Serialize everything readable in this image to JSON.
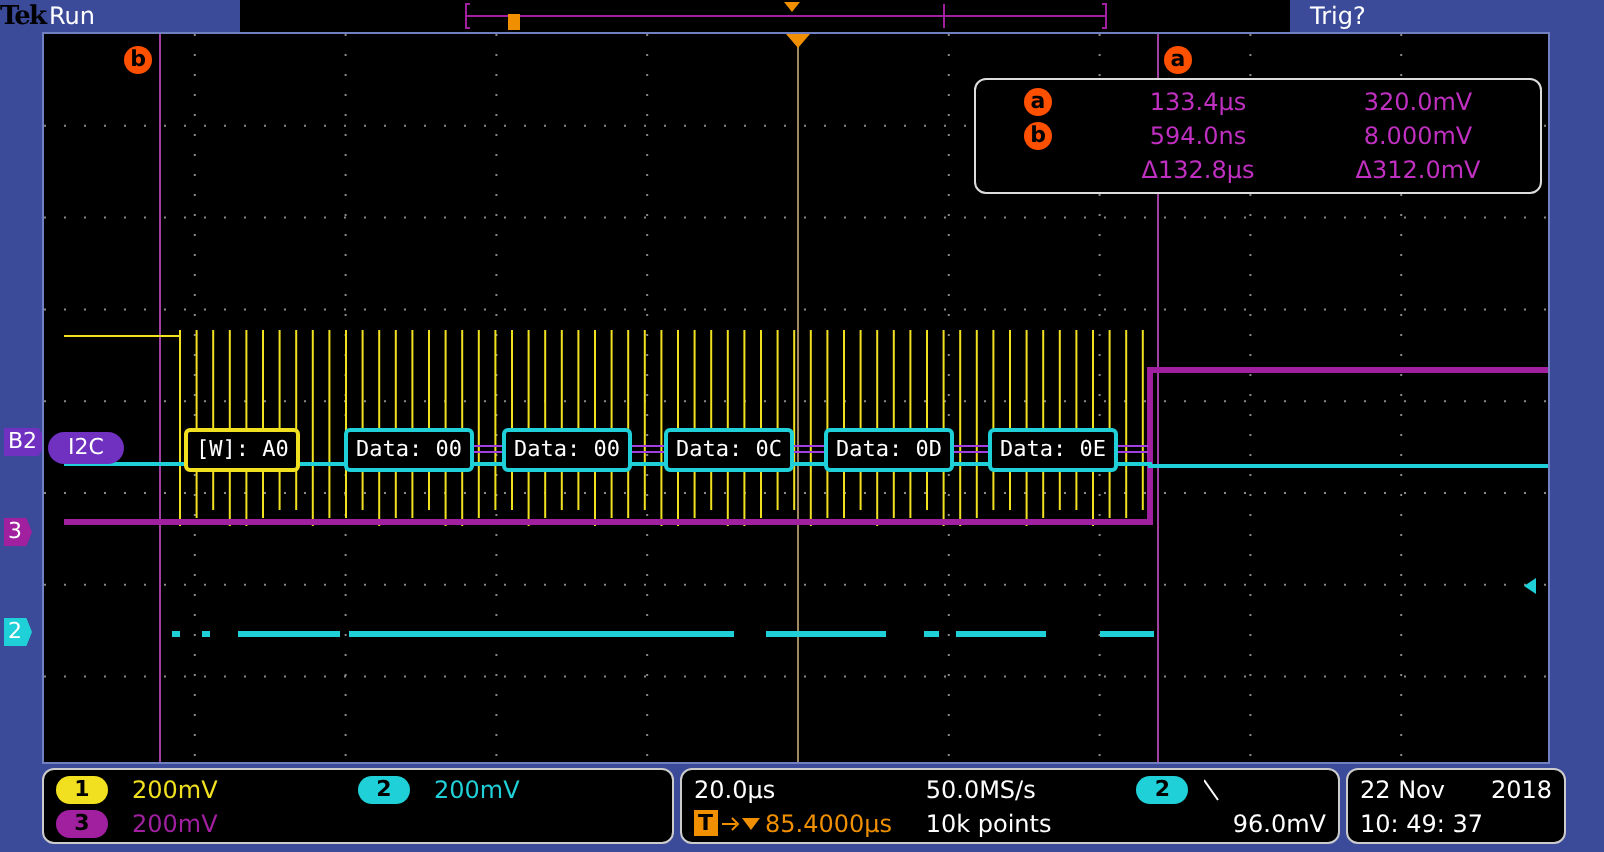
{
  "header": {
    "brand": "Tek",
    "status": "Run",
    "trigger_status": "Trig?"
  },
  "cursor_labels": [
    {
      "marker": "b"
    },
    {
      "marker": "a"
    }
  ],
  "readout": [
    {
      "marker": "a",
      "time": "133.4µs",
      "value": "320.0mV"
    },
    {
      "marker": "b",
      "time": "594.0ns",
      "value": "8.000mV"
    },
    {
      "time": "Δ132.8µs",
      "value": "Δ312.0mV"
    }
  ],
  "side_markers": [
    {
      "label": "B2",
      "color": "#7030c0"
    },
    {
      "label": "3",
      "color": "#a020a0"
    },
    {
      "label": "2",
      "color": "#20d0d8"
    }
  ],
  "bus": {
    "name": "I2C",
    "packets": [
      {
        "kind": "address",
        "text": "[W]: A0"
      },
      {
        "kind": "data",
        "text": "Data: 00"
      },
      {
        "kind": "data",
        "text": "Data: 00"
      },
      {
        "kind": "data",
        "text": "Data: 0C"
      },
      {
        "kind": "data",
        "text": "Data: 0D"
      },
      {
        "kind": "data",
        "text": "Data: 0E"
      }
    ]
  },
  "channels": [
    {
      "number": "1",
      "scale": "200mV",
      "color": "#f0e020"
    },
    {
      "number": "2",
      "scale": "200mV",
      "color": "#20d0d8"
    },
    {
      "number": "3",
      "scale": "200mV",
      "color": "#a020a0"
    }
  ],
  "timebase": {
    "scale": "20.0µs",
    "sample_rate": "50.0MS/s",
    "trigger_badge": "T",
    "trigger_position": "85.4000µs",
    "record_length": "10k points",
    "trigger_source": "2",
    "trigger_level": "96.0mV"
  },
  "clock": {
    "date": "22 Nov",
    "year": "2018",
    "time": "10: 49: 37"
  }
}
